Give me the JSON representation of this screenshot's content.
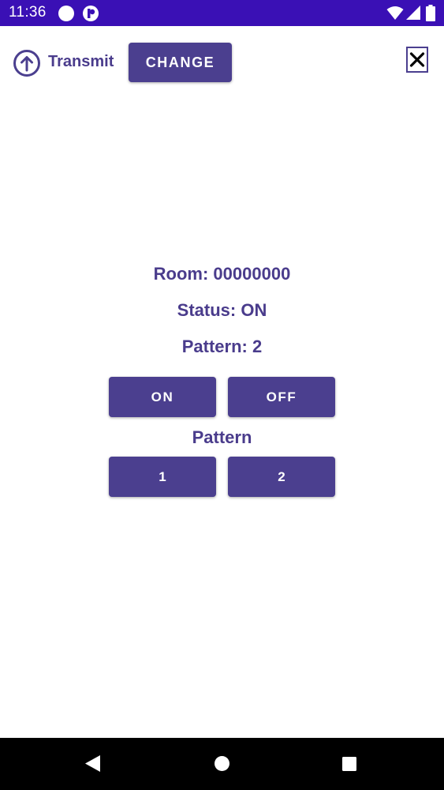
{
  "status_bar": {
    "time": "11:36",
    "background": "#3a10b5",
    "left_icons": [
      "circle-icon",
      "app-badge-icon"
    ],
    "right_icons": [
      "wifi-icon",
      "signal-icon",
      "battery-icon"
    ]
  },
  "toolbar": {
    "transmit_icon": "arrow-up-circle-icon",
    "transmit_label": "Transmit",
    "change_label": "CHANGE",
    "close_icon": "close-icon"
  },
  "main": {
    "room": "Room: 00000000",
    "status": "Status: ON",
    "pattern_current": "Pattern: 2",
    "on_label": "ON",
    "off_label": "OFF",
    "pattern_heading": "Pattern",
    "pattern_buttons": [
      "1",
      "2"
    ]
  },
  "nav_bar": {
    "icons": [
      "back-icon",
      "home-icon",
      "recents-icon"
    ]
  },
  "colors": {
    "accent": "#4b3f8f",
    "text": "#4a3c8c",
    "status_bar": "#3a10b5"
  }
}
